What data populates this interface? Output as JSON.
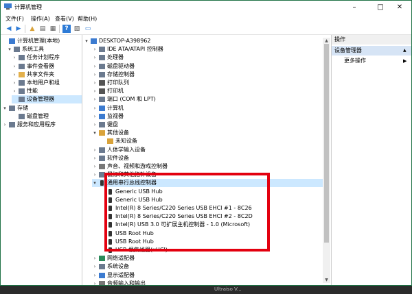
{
  "window": {
    "title": "计算机管理"
  },
  "menu": [
    "文件(F)",
    "操作(A)",
    "查看(V)",
    "帮助(H)"
  ],
  "left_tree": [
    {
      "label": "计算机管理(本地)",
      "indent": 0,
      "exp": "",
      "icon": "computer-icon"
    },
    {
      "label": "系统工具",
      "indent": 1,
      "exp": "▾",
      "icon": "tools-icon"
    },
    {
      "label": "任务计划程序",
      "indent": 2,
      "exp": "›",
      "icon": "clock-icon"
    },
    {
      "label": "事件查看器",
      "indent": 2,
      "exp": "›",
      "icon": "event-icon"
    },
    {
      "label": "共享文件夹",
      "indent": 2,
      "exp": "›",
      "icon": "folder-icon"
    },
    {
      "label": "本地用户和组",
      "indent": 2,
      "exp": "›",
      "icon": "users-icon"
    },
    {
      "label": "性能",
      "indent": 2,
      "exp": "›",
      "icon": "performance-icon"
    },
    {
      "label": "设备管理器",
      "indent": 2,
      "exp": "",
      "icon": "device-manager-icon",
      "selected": true
    },
    {
      "label": "存储",
      "indent": 0,
      "exp": "▾",
      "icon": "storage-icon"
    },
    {
      "label": "磁盘管理",
      "indent": 2,
      "exp": "",
      "icon": "disk-icon"
    },
    {
      "label": "服务和应用程序",
      "indent": 0,
      "exp": "›",
      "icon": "services-icon"
    }
  ],
  "device_tree": [
    {
      "label": "DESKTOP-A398962",
      "indent": 0,
      "exp": "▾",
      "icon": "computer-icon"
    },
    {
      "label": "IDE ATA/ATAPI 控制器",
      "indent": 1,
      "exp": "›",
      "icon": "ide-icon"
    },
    {
      "label": "处理器",
      "indent": 1,
      "exp": "›",
      "icon": "cpu-icon"
    },
    {
      "label": "磁盘驱动器",
      "indent": 1,
      "exp": "›",
      "icon": "disk-icon"
    },
    {
      "label": "存储控制器",
      "indent": 1,
      "exp": "›",
      "icon": "storage-controller-icon"
    },
    {
      "label": "打印队列",
      "indent": 1,
      "exp": "›",
      "icon": "printer-icon"
    },
    {
      "label": "打印机",
      "indent": 1,
      "exp": "›",
      "icon": "printer-icon"
    },
    {
      "label": "端口 (COM 和 LPT)",
      "indent": 1,
      "exp": "›",
      "icon": "port-icon"
    },
    {
      "label": "计算机",
      "indent": 1,
      "exp": "›",
      "icon": "computer-icon"
    },
    {
      "label": "监视器",
      "indent": 1,
      "exp": "›",
      "icon": "monitor-icon"
    },
    {
      "label": "键盘",
      "indent": 1,
      "exp": "›",
      "icon": "keyboard-icon"
    },
    {
      "label": "其他设备",
      "indent": 1,
      "exp": "▾",
      "icon": "other-device-icon"
    },
    {
      "label": "未知设备",
      "indent": 2,
      "exp": "",
      "icon": "unknown-device-icon"
    },
    {
      "label": "人体学输入设备",
      "indent": 1,
      "exp": "›",
      "icon": "hid-icon"
    },
    {
      "label": "软件设备",
      "indent": 1,
      "exp": "›",
      "icon": "software-device-icon"
    },
    {
      "label": "声音、视频和游戏控制器",
      "indent": 1,
      "exp": "›",
      "icon": "sound-icon"
    },
    {
      "label": "鼠标和其他指针设备",
      "indent": 1,
      "exp": "›",
      "icon": "mouse-icon"
    },
    {
      "label": "通用串行总线控制器",
      "indent": 1,
      "exp": "▾",
      "icon": "usb-icon",
      "selected": true
    },
    {
      "label": "Generic USB Hub",
      "indent": 2,
      "exp": "",
      "icon": "usb-icon"
    },
    {
      "label": "Generic USB Hub",
      "indent": 2,
      "exp": "",
      "icon": "usb-icon"
    },
    {
      "label": "Intel(R) 8 Series/C220 Series USB EHCI #1 - 8C26",
      "indent": 2,
      "exp": "",
      "icon": "usb-icon"
    },
    {
      "label": "Intel(R) 8 Series/C220 Series USB EHCI #2 - 8C2D",
      "indent": 2,
      "exp": "",
      "icon": "usb-icon"
    },
    {
      "label": "Intel(R) USB 3.0 可扩展主机控制器 - 1.0 (Microsoft)",
      "indent": 2,
      "exp": "",
      "icon": "usb-icon"
    },
    {
      "label": "USB Root Hub",
      "indent": 2,
      "exp": "",
      "icon": "usb-icon"
    },
    {
      "label": "USB Root Hub",
      "indent": 2,
      "exp": "",
      "icon": "usb-icon"
    },
    {
      "label": "USB 根集线器(xHCI)",
      "indent": 2,
      "exp": "",
      "icon": "usb-icon"
    },
    {
      "label": "网络适配器",
      "indent": 1,
      "exp": "›",
      "icon": "network-icon"
    },
    {
      "label": "系统设备",
      "indent": 1,
      "exp": "›",
      "icon": "system-device-icon"
    },
    {
      "label": "显示适配器",
      "indent": 1,
      "exp": "›",
      "icon": "display-adapter-icon"
    },
    {
      "label": "音频输入和输出",
      "indent": 1,
      "exp": "›",
      "icon": "audio-icon"
    }
  ],
  "actions": {
    "header": "操作",
    "section": "设备管理器",
    "more": "更多操作"
  },
  "taskbar": [
    "Ultraiso V..."
  ],
  "colors": {
    "accent": "#1e7145",
    "highlight": "#e3000f",
    "selection": "#cce8ff"
  }
}
